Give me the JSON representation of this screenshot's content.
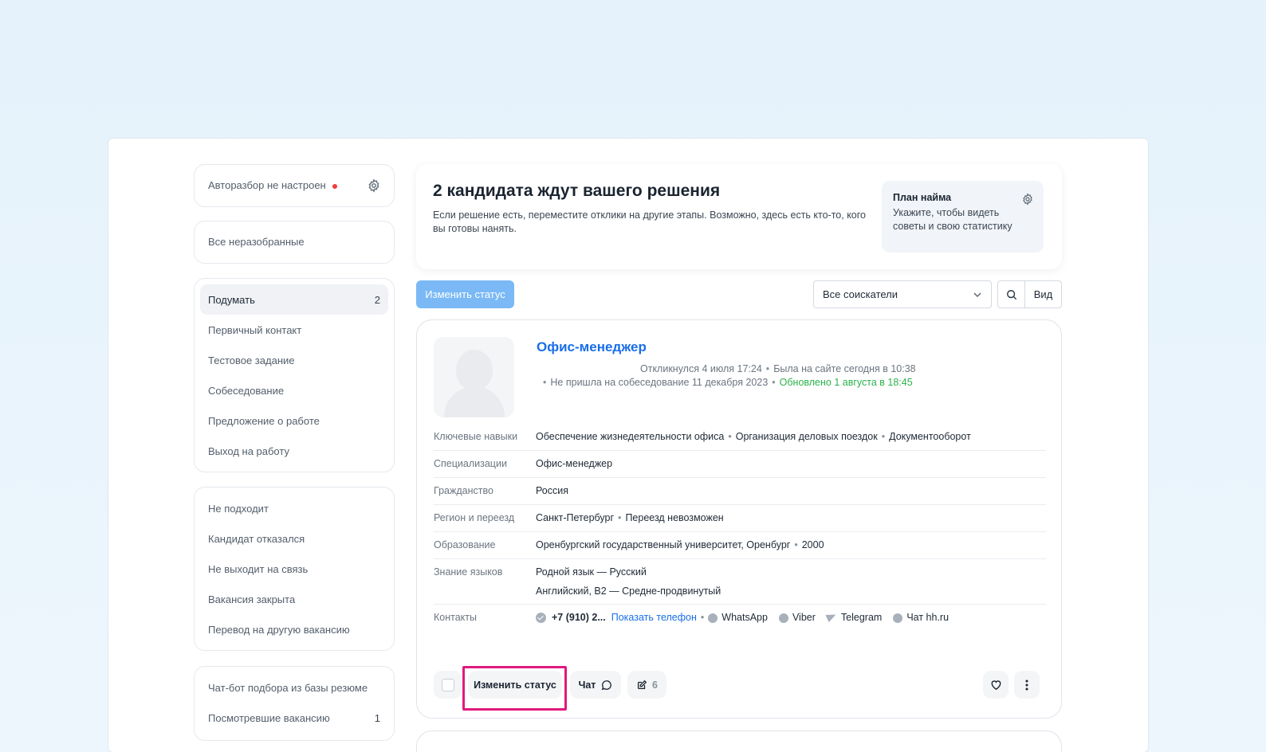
{
  "sidebar": {
    "auto_label": "Авторазбор не настроен",
    "all_label": "Все неразобранные",
    "stages": [
      {
        "label": "Подумать",
        "count": "2"
      },
      {
        "label": "Первичный контакт",
        "count": ""
      },
      {
        "label": "Тестовое задание",
        "count": ""
      },
      {
        "label": "Собеседование",
        "count": ""
      },
      {
        "label": "Предложение о работе",
        "count": ""
      },
      {
        "label": "Выход на работу",
        "count": ""
      }
    ],
    "rejects": [
      {
        "label": "Не подходит"
      },
      {
        "label": "Кандидат отказался"
      },
      {
        "label": "Не выходит на связь"
      },
      {
        "label": "Вакансия закрыта"
      },
      {
        "label": "Перевод на другую вакансию"
      }
    ],
    "extra": [
      {
        "label": "Чат-бот подбора из базы резюме",
        "count": ""
      },
      {
        "label": "Посмотревшие вакансию",
        "count": "1"
      }
    ]
  },
  "header": {
    "title": "2 кандидата ждут вашего решения",
    "desc": "Если решение есть, переместите отклики на другие этапы. Возможно, здесь есть кто-то, кого вы готовы нанять.",
    "plan_title": "План найма",
    "plan_desc": "Укажите, чтобы видеть советы и свою статистику"
  },
  "toolbar": {
    "change_status": "Изменить статус",
    "filter_value": "Все соискатели",
    "view_label": "Вид"
  },
  "candidate": {
    "title": "Офис-менеджер",
    "responded": "Откликнулся 4 июля 17:24",
    "last_seen": "Была на сайте сегодня в 10:38",
    "no_show": "Не пришла на собеседование 11 декабря 2023",
    "updated": "Обновлено 1 августа в 18:45",
    "rows": {
      "skills_key": "Ключевые навыки",
      "skill_1": "Обеспечение жизнедеятельности офиса",
      "skill_2": "Организация деловых поездок",
      "skill_3": "Документооборот",
      "spec_key": "Специализации",
      "spec_val": "Офис-менеджер",
      "citizen_key": "Гражданство",
      "citizen_val": "Россия",
      "region_key": "Регион и переезд",
      "region_val": "Санкт-Петербург",
      "relocation_val": "Переезд невозможен",
      "edu_key": "Образование",
      "edu_val": "Оренбургский государственный университет, Оренбург",
      "edu_year": "2000",
      "lang_key": "Знание языков",
      "lang_1": "Родной язык — Русский",
      "lang_2": "Английский, B2 — Средне-продвинутый",
      "contacts_key": "Контакты",
      "phone": "+7 (910) 2...",
      "show_phone": "Показать телефон",
      "whatsapp": "WhatsApp",
      "viber": "Viber",
      "telegram": "Telegram",
      "hh_chat": "Чат hh.ru"
    },
    "actions": {
      "change_status": "Изменить статус",
      "chat": "Чат",
      "notes_count": "6"
    }
  },
  "colors": {
    "accent": "#1a6ee8",
    "highlight": "#e0197d",
    "updated_green": "#2bb24c"
  }
}
